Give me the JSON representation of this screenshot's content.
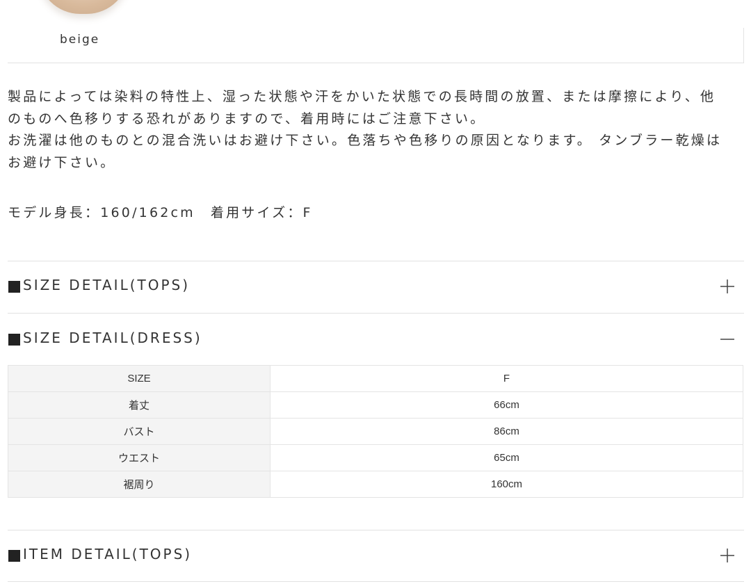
{
  "color_swatch": {
    "label": "beige"
  },
  "description": {
    "line1": "製品によっては染料の特性上、湿った状態や汗をかいた状態での長時間の放置、または摩擦により、他",
    "line2": "のものへ色移りする恐れがありますので、着用時にはご注意下さい。",
    "line3": "お洗濯は他のものとの混合洗いはお避け下さい。色落ちや色移りの原因となります。 タンブラー乾燥は",
    "line4": "お避け下さい。"
  },
  "model_info": {
    "height_text": "モデル身長：160/162cm",
    "size_text": "着用サイズ：F"
  },
  "sections": {
    "size_tops": {
      "title": "SIZE DETAIL(TOPS)",
      "state": "collapsed"
    },
    "size_dress": {
      "title": "SIZE DETAIL(DRESS)",
      "state": "expanded",
      "table": {
        "header": {
          "label": "SIZE",
          "value": "F"
        },
        "rows": [
          {
            "label": "着丈",
            "value": "66cm"
          },
          {
            "label": "バスト",
            "value": "86cm"
          },
          {
            "label": "ウエスト",
            "value": "65cm"
          },
          {
            "label": "裾周り",
            "value": "160cm"
          }
        ]
      }
    },
    "item_tops": {
      "title": "ITEM DETAIL(TOPS)",
      "state": "collapsed"
    }
  },
  "icons": {
    "expand": "plus-icon",
    "collapse": "minus-icon",
    "section_marker": "black-square-icon"
  },
  "colors": {
    "swatch": "#d8b99b",
    "text": "#333333",
    "divider": "#e2e2e2",
    "table_header_bg": "#f4f4f4"
  }
}
